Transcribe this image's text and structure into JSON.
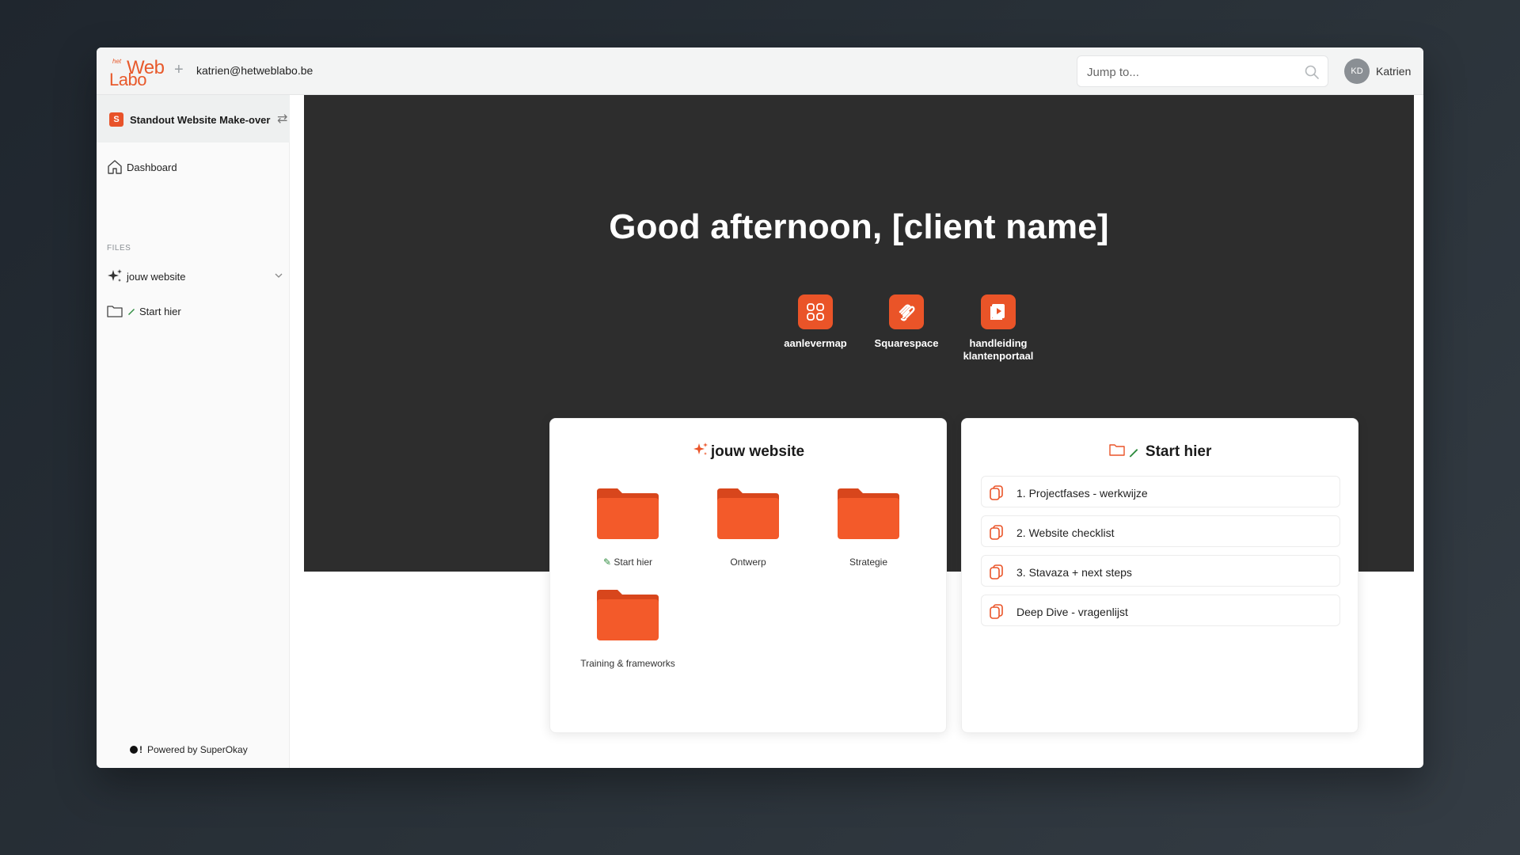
{
  "header": {
    "logo_het": "het",
    "logo_web": "Web",
    "logo_labo": "Labo",
    "email": "katrien@hetweblabo.be",
    "search_placeholder": "Jump to...",
    "avatar_initials": "KD",
    "user_name": "Katrien"
  },
  "sidebar": {
    "project_initial": "S",
    "project_name": "Standout Website Make-over",
    "dashboard": "Dashboard",
    "files_label": "FILES",
    "items": [
      {
        "label": "jouw website"
      },
      {
        "label": "Start hier"
      }
    ],
    "powered": "Powered by SuperOkay",
    "powered_bang": "!"
  },
  "hero": {
    "greeting": "Good afternoon, [client name]",
    "quick_links": [
      {
        "label": "aanlevermap",
        "icon": "grid-icon"
      },
      {
        "label": "Squarespace",
        "icon": "squarespace-icon"
      },
      {
        "label": "handleiding klantenportaal",
        "icon": "video-icon"
      }
    ]
  },
  "cards": {
    "website": {
      "title": "jouw website",
      "folders": [
        "Start hier",
        "Ontwerp",
        "Strategie",
        "Training & frameworks"
      ]
    },
    "start": {
      "title": "Start hier",
      "docs": [
        "1. Projectfases - werkwijze",
        "2. Website checklist",
        "3. Stavaza + next steps",
        "Deep Dive - vragenlijst"
      ]
    }
  },
  "colors": {
    "accent": "#ea5428",
    "hero_bg": "#2d2d2d",
    "pencil_green": "#2e8b3e"
  }
}
